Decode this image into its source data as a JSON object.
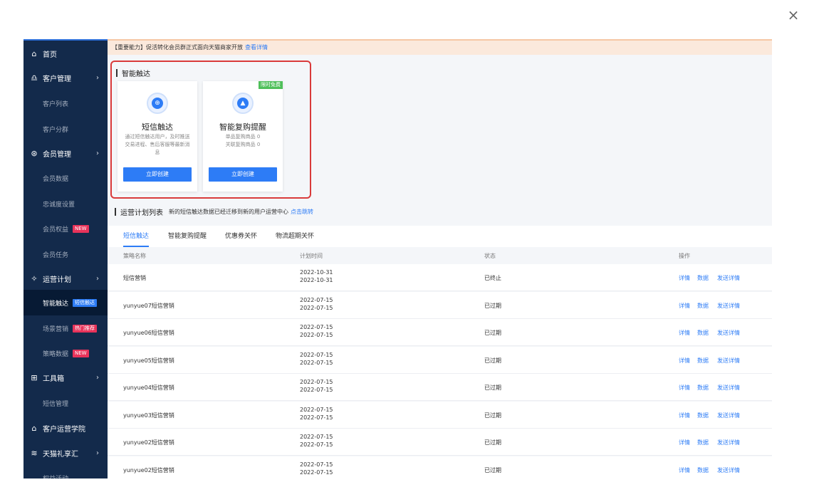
{
  "dialog": {
    "close_icon": "×"
  },
  "sidebar": {
    "items": [
      {
        "type": "main",
        "icon": "⌂",
        "label": "首页"
      },
      {
        "type": "main",
        "icon": "♎",
        "label": "客户管理",
        "chevron": "›"
      },
      {
        "type": "sub",
        "label": "客户列表"
      },
      {
        "type": "sub",
        "label": "客户分群"
      },
      {
        "type": "main",
        "icon": "⊛",
        "label": "会员管理",
        "chevron": "›"
      },
      {
        "type": "sub",
        "label": "会员数据"
      },
      {
        "type": "sub",
        "label": "忠诚度设置"
      },
      {
        "type": "sub",
        "label": "会员权益",
        "tag": "NEW",
        "tag_color": "red"
      },
      {
        "type": "sub",
        "label": "会员任务"
      },
      {
        "type": "main",
        "icon": "✧",
        "label": "运营计划",
        "chevron": "›"
      },
      {
        "type": "sub",
        "label": "智能触达",
        "tag": "短信触达",
        "tag_color": "blue",
        "active": true
      },
      {
        "type": "sub",
        "label": "场景营销",
        "tag": "热门推荐",
        "tag_color": "red"
      },
      {
        "type": "sub",
        "label": "策略数据",
        "tag": "NEW",
        "tag_color": "red"
      },
      {
        "type": "main",
        "icon": "⊞",
        "label": "工具箱",
        "chevron": "›"
      },
      {
        "type": "sub",
        "label": "短信管理"
      },
      {
        "type": "main",
        "icon": "⌂",
        "label": "客户运营学院"
      },
      {
        "type": "main",
        "icon": "≋",
        "label": "天猫礼享汇",
        "chevron": "›"
      },
      {
        "type": "sub",
        "label": "权益活动"
      }
    ]
  },
  "banner": {
    "text": "【重要能力】促活转化会员群正式面向天猫商家开放",
    "link": "查看详情"
  },
  "smart_reach": {
    "title": "智能触达",
    "cards": [
      {
        "icon": "⊕",
        "title": "短信触达",
        "desc": "通过短信触达用户，及时推送交易进程、售后客服等最新消息",
        "button": "立即创建"
      },
      {
        "icon": "▲",
        "title": "智能复购提醒",
        "desc_lines": [
          "单品复购商品 0",
          "关联复购商品 0"
        ],
        "badge": "限时免费",
        "button": "立即创建"
      }
    ]
  },
  "plan_list": {
    "title": "运营计划列表",
    "notice": "新的短信触达数据已经迁移到新的用户运营中心",
    "notice_link": "点击跳转"
  },
  "tabs": [
    "短信触达",
    "智能复购提醒",
    "优惠券关怀",
    "物流超期关怀"
  ],
  "table": {
    "headers": [
      "策略名称",
      "计划时间",
      "状态",
      "操作"
    ],
    "actions": [
      "详情",
      "数据",
      "发送详情"
    ],
    "rows": [
      {
        "name": "短信营销",
        "start": "2022-10-31",
        "end": "2022-10-31",
        "status": "已终止"
      },
      {
        "name": "yunyue07短信营销",
        "start": "2022-07-15",
        "end": "2022-07-15",
        "status": "已过期"
      },
      {
        "name": "yunyue06短信营销",
        "start": "2022-07-15",
        "end": "2022-07-15",
        "status": "已过期"
      },
      {
        "name": "yunyue05短信营销",
        "start": "2022-07-15",
        "end": "2022-07-15",
        "status": "已过期"
      },
      {
        "name": "yunyue04短信营销",
        "start": "2022-07-15",
        "end": "2022-07-15",
        "status": "已过期"
      },
      {
        "name": "yunyue03短信营销",
        "start": "2022-07-15",
        "end": "2022-07-15",
        "status": "已过期"
      },
      {
        "name": "yunyue02短信营销",
        "start": "2022-07-15",
        "end": "2022-07-15",
        "status": "已过期"
      },
      {
        "name": "yunyue02短信营销",
        "start": "2022-07-15",
        "end": "2022-07-15",
        "status": "已过期"
      }
    ]
  }
}
